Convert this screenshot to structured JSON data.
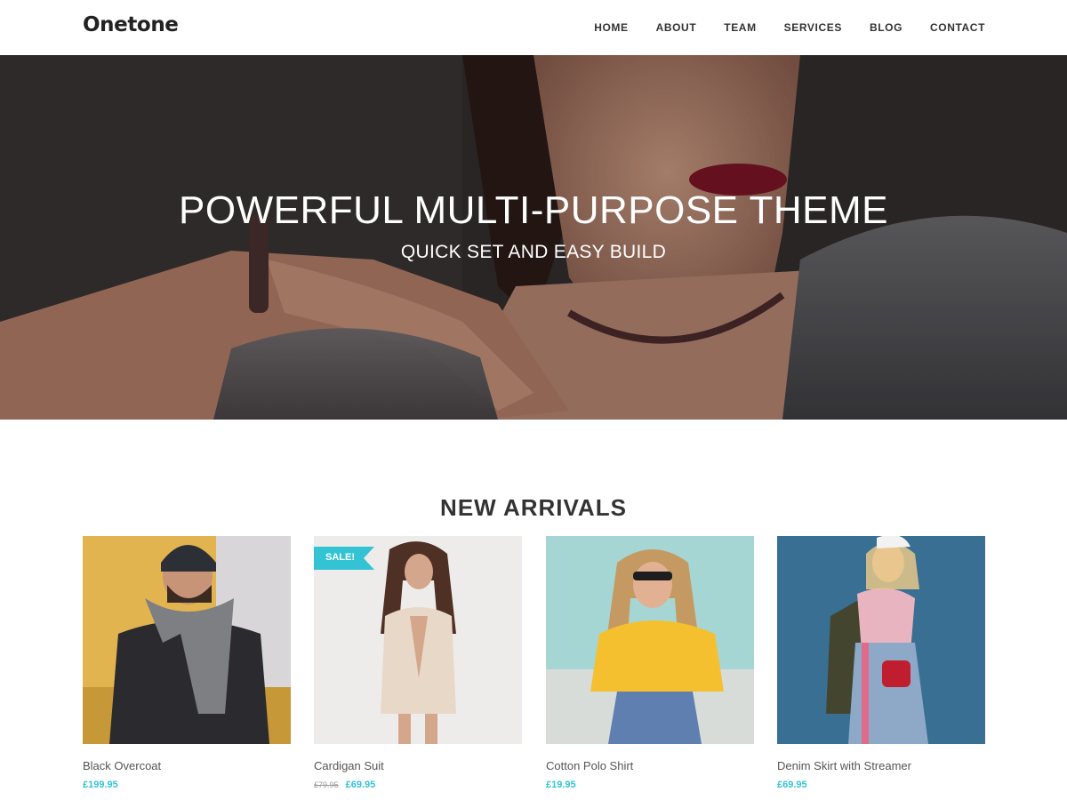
{
  "header": {
    "logo": "Onetone",
    "nav": [
      "HOME",
      "ABOUT",
      "TEAM",
      "SERVICES",
      "BLOG",
      "CONTACT"
    ]
  },
  "hero": {
    "title": "POWERFUL MULTI-PURPOSE THEME",
    "subtitle": "QUICK SET AND EASY BUILD"
  },
  "arrivals": {
    "title": "NEW ARRIVALS",
    "products": [
      {
        "name": "Black Overcoat",
        "price": "£199.95",
        "old_price": ""
      },
      {
        "name": "Cardigan Suit",
        "price": "£69.95",
        "old_price": "£79.95",
        "badge": "SALE!"
      },
      {
        "name": "Cotton Polo Shirt",
        "price": "£19.95",
        "old_price": ""
      },
      {
        "name": "Denim Skirt with Streamer",
        "price": "£69.95",
        "old_price": ""
      }
    ]
  },
  "colors": {
    "accent": "#33c3d5",
    "text": "#333333",
    "price": "#33c3d5"
  }
}
